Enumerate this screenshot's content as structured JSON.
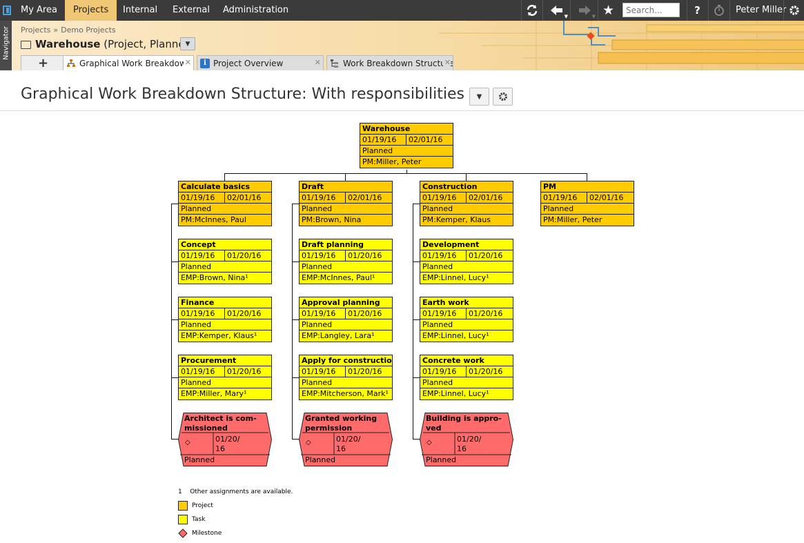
{
  "topnav": {
    "tabs": [
      "My Area",
      "Projects",
      "Internal",
      "External",
      "Administration"
    ],
    "search_placeholder": "Search...",
    "user": "Peter Miller",
    "help": "?"
  },
  "navigator_label": "Navigator",
  "breadcrumbs": [
    "Projects",
    "Demo Projects"
  ],
  "breadcrumb_sep": "»",
  "project": {
    "name": "Warehouse",
    "meta": "(Project, Planned)"
  },
  "add_tab_label": "+",
  "tabs": [
    {
      "label": "Graphical Work Breakdown Structure",
      "active": true
    },
    {
      "label": "Project Overview",
      "active": false
    },
    {
      "label": "Work Breakdown Structure",
      "active": false
    }
  ],
  "page": {
    "title": "Graphical Work Breakdown Structure: With responsibilities"
  },
  "colors": {
    "project": "#ffcc00",
    "task": "#ffff00",
    "milestone": "#ff6b6b",
    "accent": "#f0c875"
  },
  "wbs": {
    "root": {
      "name": "Warehouse",
      "start": "01/19/16",
      "end": "02/01/16",
      "status": "Planned",
      "resp": "PM:Miller, Peter"
    },
    "columns": [
      {
        "header": {
          "name": "Calculate basics",
          "start": "01/19/16",
          "end": "02/01/16",
          "status": "Planned",
          "resp": "PM:McInnes, Paul"
        },
        "tasks": [
          {
            "name": "Concept",
            "start": "01/19/16",
            "end": "01/20/16",
            "status": "Planned",
            "resp": "EMP:Brown, Nina¹"
          },
          {
            "name": "Finance",
            "start": "01/19/16",
            "end": "01/20/16",
            "status": "Planned",
            "resp": "EMP:Kemper, Klaus¹"
          },
          {
            "name": "Procurement",
            "start": "01/19/16",
            "end": "01/20/16",
            "status": "Planned",
            "resp": "EMP:Miller, Mary¹"
          }
        ],
        "milestone": {
          "name1": "Architect is com-",
          "name2": "missioned",
          "mark": "◇",
          "date1": "01/20/",
          "date2": "16",
          "status": "Planned"
        }
      },
      {
        "header": {
          "name": "Draft",
          "start": "01/19/16",
          "end": "02/01/16",
          "status": "Planned",
          "resp": "PM:Brown, Nina"
        },
        "tasks": [
          {
            "name": "Draft planning",
            "start": "01/19/16",
            "end": "01/20/16",
            "status": "Planned",
            "resp": "EMP:McInnes, Paul¹"
          },
          {
            "name": "Approval planning",
            "start": "01/19/16",
            "end": "01/20/16",
            "status": "Planned",
            "resp": "EMP:Langley, Lara¹"
          },
          {
            "name": "Apply for construction",
            "start": "01/19/16",
            "end": "01/20/16",
            "status": "Planned",
            "resp": "EMP:Mitcherson, Mark¹"
          }
        ],
        "milestone": {
          "name1": "Granted working",
          "name2": "permission",
          "mark": "◇",
          "date1": "01/20/",
          "date2": "16",
          "status": "Planned"
        }
      },
      {
        "header": {
          "name": "Construction",
          "start": "01/19/16",
          "end": "02/01/16",
          "status": "Planned",
          "resp": "PM:Kemper, Klaus"
        },
        "tasks": [
          {
            "name": "Development",
            "start": "01/19/16",
            "end": "01/20/16",
            "status": "Planned",
            "resp": "EMP:Linnel, Lucy¹"
          },
          {
            "name": "Earth work",
            "start": "01/19/16",
            "end": "01/20/16",
            "status": "Planned",
            "resp": "EMP:Linnel, Lucy¹"
          },
          {
            "name": "Concrete work",
            "start": "01/19/16",
            "end": "01/20/16",
            "status": "Planned",
            "resp": "EMP:Linnel, Lucy¹"
          }
        ],
        "milestone": {
          "name1": "Building is appro-",
          "name2": "ved",
          "mark": "◇",
          "date1": "01/20/",
          "date2": "16",
          "status": "Planned"
        }
      },
      {
        "header": {
          "name": "PM",
          "start": "01/19/16",
          "end": "02/01/16",
          "status": "Planned",
          "resp": "PM:Miller, Peter"
        },
        "tasks": [],
        "milestone": null
      }
    ]
  },
  "legend": {
    "footnote_mark": "1",
    "footnote": "Other assignments are available.",
    "project": "Project",
    "task": "Task",
    "milestone": "Milestone"
  }
}
